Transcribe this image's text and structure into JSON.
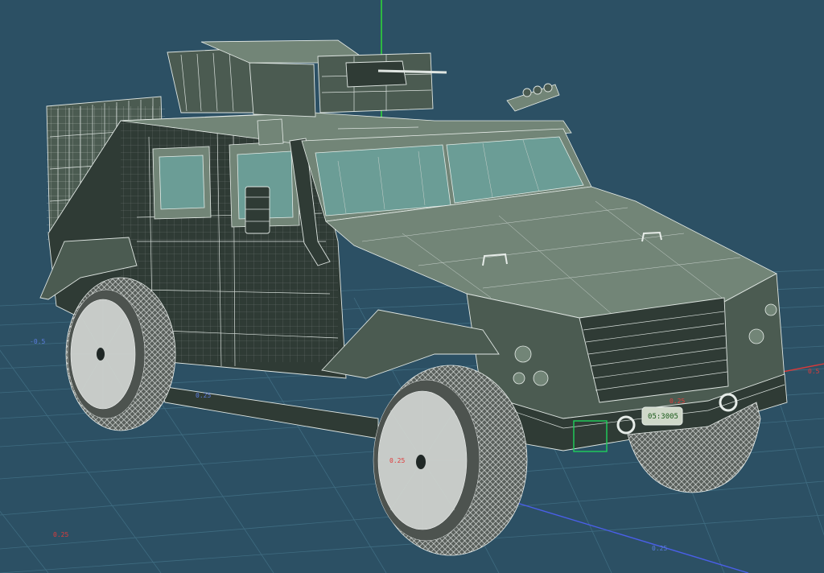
{
  "viewport": {
    "background": "#2c5064",
    "grid_color": "#3f6b80",
    "axis_colors": {
      "x": "#d83a3a",
      "y": "#2fd23a",
      "z": "#4a5fe8"
    }
  },
  "model": {
    "wire_color": "#e0e6e2",
    "body_color": "#4b5b51",
    "glass_color": "#6aa5a0",
    "selection_color": "#1fd15c",
    "license_plate": "05:3005"
  },
  "grid_labels": [
    {
      "text": "-0.5",
      "color": "blue"
    },
    {
      "text": "0.25",
      "color": "blue"
    },
    {
      "text": "0.25",
      "color": "blue"
    },
    {
      "text": "0.25",
      "color": "red"
    },
    {
      "text": "0.25",
      "color": "red"
    },
    {
      "text": "0.25",
      "color": "red"
    },
    {
      "text": "0.5",
      "color": "red"
    }
  ]
}
